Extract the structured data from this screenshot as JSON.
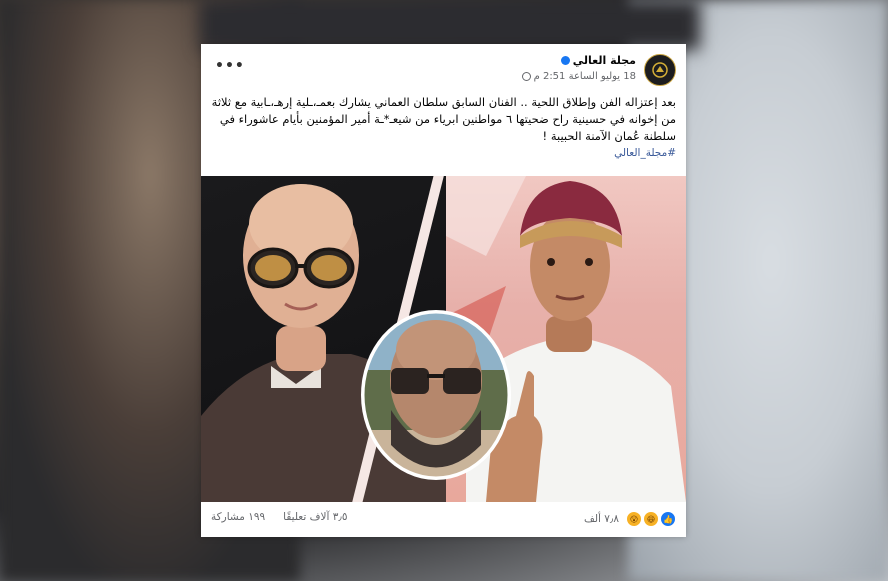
{
  "post": {
    "page_name": "مجلة العالي",
    "date": "18 يوليو الساعة 2:51 م",
    "more_label": "•••",
    "text": "بعد إعتزاله الفن وإطلاق اللحية .. الفنان السابق سلطان العماني يشارك بعمـ،ـلية إرهـ،ـابية مع ثلاثة من إخوانه في حسينية راح ضحيتها ٦ مواطنين ابرياء من شيعـ*ـة أمير المؤمنين بأيام عاشوراء في سلطنة عُمان الآمنة الحبيبة !",
    "hashtag": "#مجلة_العالي",
    "reactions_count": "٧٫٨ ألف",
    "comments": "٣٫٥ آلاف تعليقًا",
    "shares": "١٩٩ مشاركة"
  },
  "icons": [
    "avatar-logo",
    "verified-badge",
    "globe-icon",
    "like-icon",
    "haha-icon",
    "wow-icon"
  ]
}
